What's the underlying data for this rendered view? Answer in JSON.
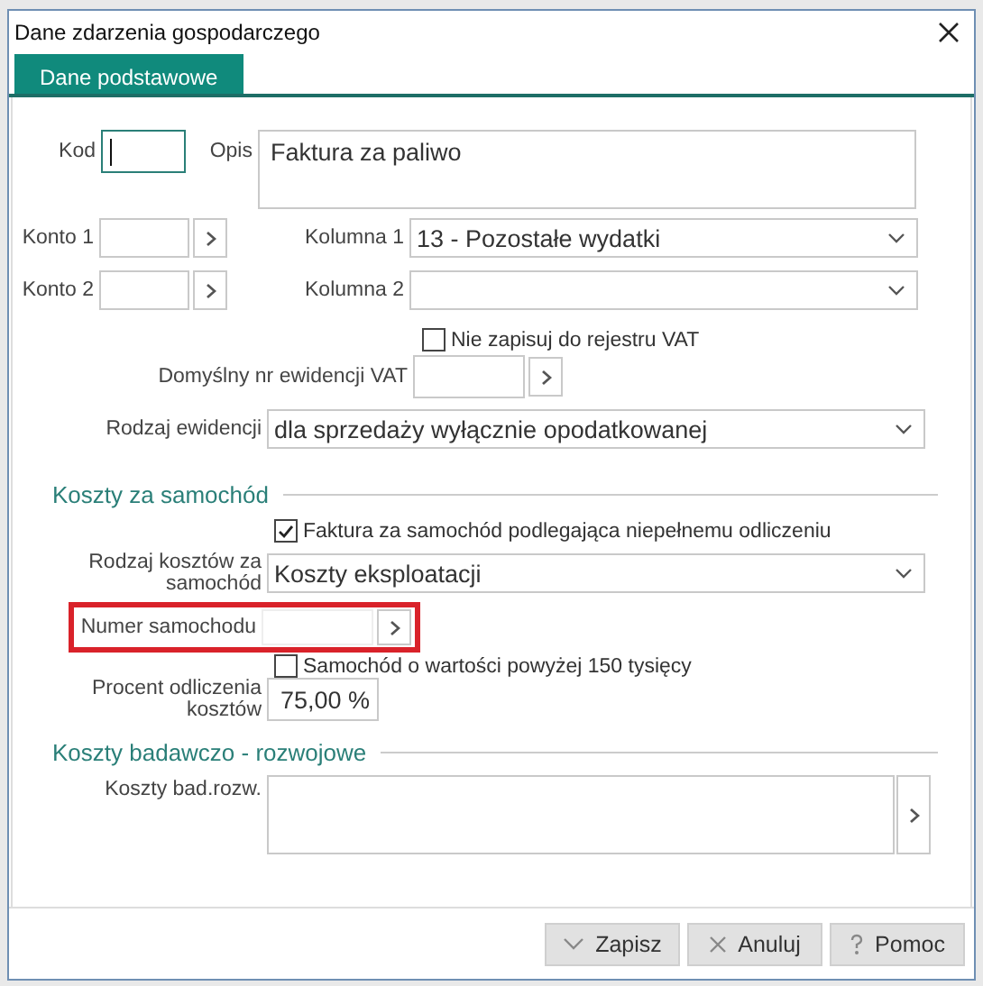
{
  "window": {
    "title": "Dane zdarzenia gospodarczego"
  },
  "tabs": [
    {
      "label": "Dane podstawowe",
      "selected": true
    }
  ],
  "general": {
    "kod": {
      "label": "Kod",
      "focused": true
    },
    "opis": {
      "label": "Opis",
      "value": "Faktura za paliwo"
    },
    "konta": [
      {
        "label": "Konto 1"
      },
      {
        "label": "Konto 2"
      }
    ],
    "kolumny": [
      {
        "label": "Kolumna 1",
        "value": "13 - Pozostałe wydatki"
      },
      {
        "label": "Kolumna 2"
      }
    ],
    "nie_zapisuj": {
      "label": "Nie zapisuj do rejestru VAT",
      "checked": false
    },
    "domyslny_nr": {
      "label": "Domyślny nr ewidencji VAT"
    },
    "rodzaj_ewidencji": {
      "label": "Rodzaj ewidencji",
      "value": "dla sprzedaży wyłącznie opodatkowanej"
    }
  },
  "car_costs": {
    "title": "Koszty za samochód",
    "partial_deduction": {
      "label": "Faktura za samochód podlegająca niepełnemu odliczeniu",
      "checked": true
    },
    "cost_type": {
      "label": "Rodzaj kosztów za samochód",
      "value": "Koszty eksploatacji"
    },
    "car_number": {
      "label": "Numer samochodu",
      "highlighted": true
    },
    "over_150k": {
      "label": "Samochód o wartości powyżej 150 tysięcy",
      "checked": false
    },
    "deduction_percent": {
      "label": "Procent odliczenia kosztów",
      "value": "75,00 %"
    }
  },
  "rd_costs": {
    "title": "Koszty badawczo - rozwojowe",
    "field": {
      "label": "Koszty bad.rozw."
    }
  },
  "buttons": [
    {
      "label": "Zapisz",
      "kind": "save"
    },
    {
      "label": "Anuluj",
      "kind": "cancel"
    },
    {
      "label": "Pomoc",
      "kind": "help"
    }
  ]
}
